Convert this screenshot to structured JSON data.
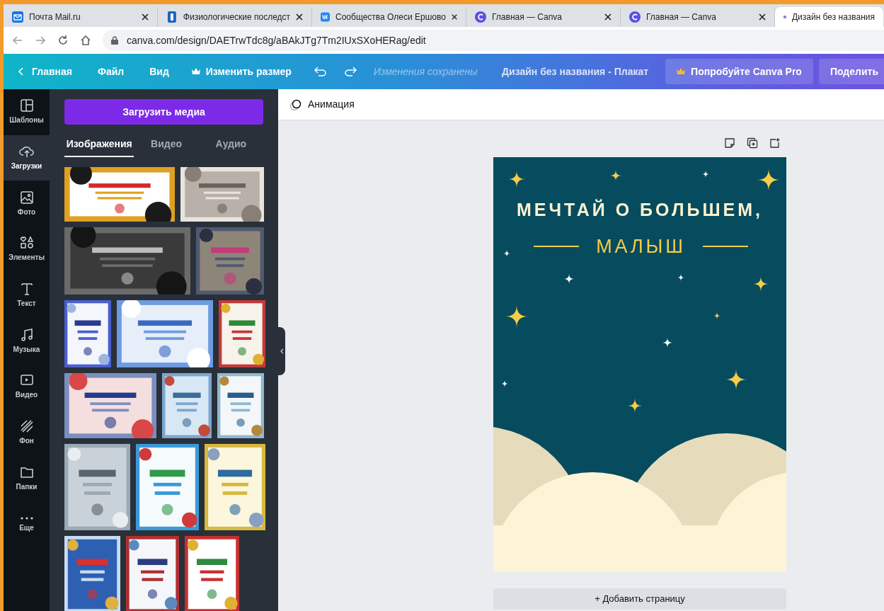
{
  "browser": {
    "tabs": [
      {
        "title": "Почта Mail.ru",
        "selected": false
      },
      {
        "title": "Физиологические последст",
        "selected": false
      },
      {
        "title": "Сообщества Олеси Ершово",
        "selected": false
      },
      {
        "title": "Главная — Canva",
        "selected": false
      },
      {
        "title": "Главная — Canva",
        "selected": false
      },
      {
        "title": "Дизайн без названия",
        "selected": true
      }
    ],
    "url": "canva.com/design/DAETrwTdc8g/aBAkJTg7Tm2IUxSXoHERag/edit"
  },
  "header": {
    "back": "Главная",
    "menus": [
      "Файл",
      "Вид"
    ],
    "resize": "Изменить размер",
    "status": "Изменения сохранены",
    "design_title": "Дизайн без названия - Плакат",
    "pro_button": "Попробуйте Canva Pro",
    "share_button": "Поделить"
  },
  "sidebar": {
    "items": [
      {
        "label": "Шаблоны",
        "selected": false
      },
      {
        "label": "Загрузки",
        "selected": true
      },
      {
        "label": "Фото",
        "selected": false
      },
      {
        "label": "Элементы",
        "selected": false
      },
      {
        "label": "Текст",
        "selected": false
      },
      {
        "label": "Музыка",
        "selected": false
      },
      {
        "label": "Видео",
        "selected": false
      },
      {
        "label": "Фон",
        "selected": false
      },
      {
        "label": "Папки",
        "selected": false
      },
      {
        "label": "Еще",
        "selected": false
      }
    ]
  },
  "panel": {
    "upload_button": "Загрузить медиа",
    "tabs": [
      {
        "label": "Изображения",
        "selected": true
      },
      {
        "label": "Видео",
        "selected": false
      },
      {
        "label": "Аудио",
        "selected": false
      }
    ]
  },
  "editor": {
    "animation_button": "Анимация",
    "poster": {
      "headline": "МЕЧТАЙ О БОЛЬШЕМ,",
      "subline": "МАЛЫШ"
    },
    "add_page": "+ Добавить страницу"
  }
}
